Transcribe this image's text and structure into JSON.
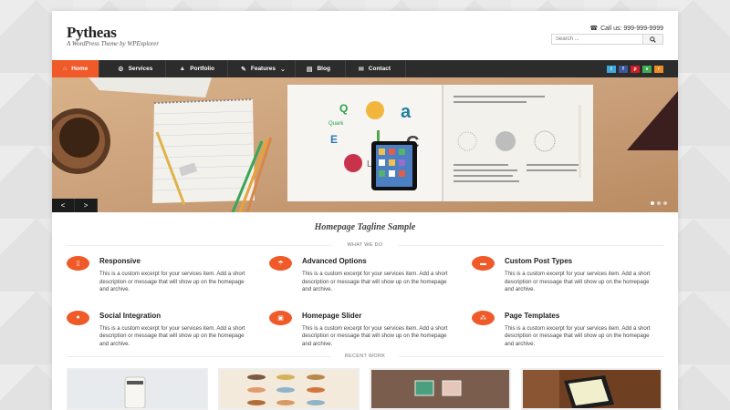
{
  "site": {
    "title": "Pytheas",
    "tagline": "A WordPress Theme by WPExplorer",
    "phone": "Call us: 999-999-9999",
    "search_placeholder": "Search ..."
  },
  "nav": {
    "items": [
      {
        "label": "Home",
        "icon": "home-icon",
        "active": true
      },
      {
        "label": "Services",
        "icon": "gear-icon",
        "active": false
      },
      {
        "label": "Portfolio",
        "icon": "portfolio-icon",
        "active": false
      },
      {
        "label": "Features",
        "icon": "pin-icon",
        "active": false
      },
      {
        "label": "Blog",
        "icon": "document-icon",
        "active": false
      },
      {
        "label": "Contact",
        "icon": "envelope-icon",
        "active": false
      }
    ],
    "social": [
      {
        "name": "twitter-icon",
        "color": "#3fa9dc"
      },
      {
        "name": "facebook-icon",
        "color": "#3b5998"
      },
      {
        "name": "pinterest-icon",
        "color": "#cb2027"
      },
      {
        "name": "vine-icon",
        "color": "#3fad54"
      },
      {
        "name": "rss-icon",
        "color": "#f08c24"
      }
    ]
  },
  "slider": {
    "prev_label": "<",
    "next_label": ">",
    "slides": 3,
    "active_slide": 1
  },
  "content": {
    "tagline": "Homepage Tagline Sample",
    "what_we_do": "WHAT WE DO",
    "recent_work": "RECENT WORK",
    "services": [
      {
        "title": "Responsive",
        "text": "This is a custom excerpt for your services item. Add a short description or message that will show up on the homepage and archive.",
        "icon": "mobile-icon"
      },
      {
        "title": "Advanced Options",
        "text": "This is a custom excerpt for your services item. Add a short description or message that will show up on the homepage and archive.",
        "icon": "umbrella-icon"
      },
      {
        "title": "Custom Post Types",
        "text": "This is a custom excerpt for your services item. Add a short description or message that will show up on the homepage and archive.",
        "icon": "briefcase-icon"
      },
      {
        "title": "Social Integration",
        "text": "This is a custom excerpt for your services item. Add a short description or message that will show up on the homepage and archive.",
        "icon": "users-icon"
      },
      {
        "title": "Homepage Slider",
        "text": "This is a custom excerpt for your services item. Add a short description or message that will show up on the homepage and archive.",
        "icon": "image-icon"
      },
      {
        "title": "Page Templates",
        "text": "This is a custom excerpt for your services item. Add a short description or message that will show up on the homepage and archive.",
        "icon": "sitemap-icon"
      }
    ]
  },
  "colors": {
    "accent": "#f05a28",
    "nav_bg": "#2c2c2c"
  }
}
